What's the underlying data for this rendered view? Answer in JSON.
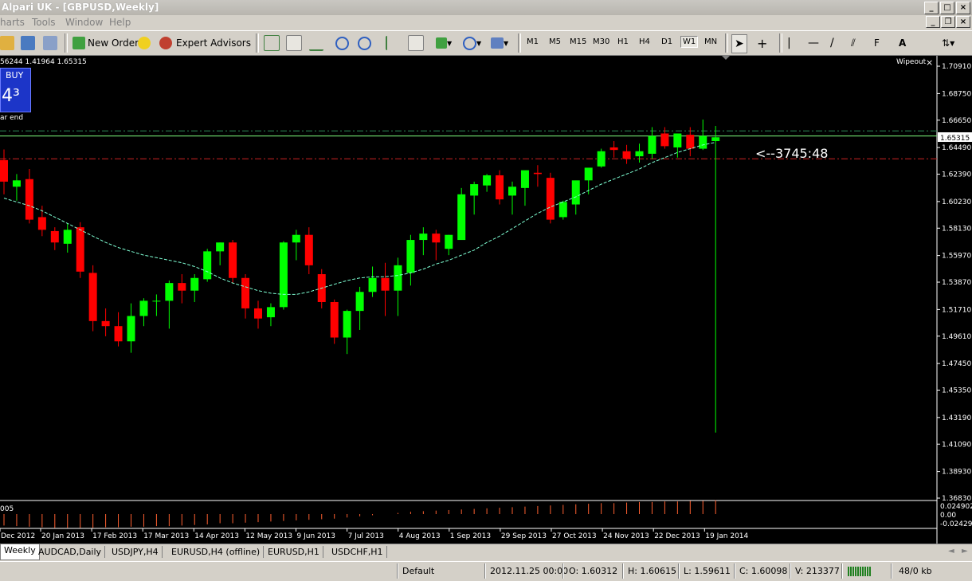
{
  "window": {
    "title": "Alpari UK - [GBPUSD,Weekly]"
  },
  "menu": [
    "harts",
    "Tools",
    "Window",
    "Help"
  ],
  "toolbar": {
    "new_order": "New Order",
    "expert_advisors": "Expert Advisors",
    "timeframes": [
      "M1",
      "M5",
      "M15",
      "M30",
      "H1",
      "H4",
      "D1",
      "W1",
      "MN"
    ],
    "active_timeframe": "W1"
  },
  "chart": {
    "ohlc_line": "56244 1.41964 1.65315",
    "buy_label": "BUY",
    "buy_price": "4³",
    "bar_end": "ar end",
    "wipeout": "Wipeout",
    "countdown": "<--3745:48",
    "indicator_label": "005"
  },
  "chart_data": {
    "type": "candlestick",
    "symbol": "GBPUSD",
    "timeframe": "Weekly",
    "ylim": [
      1.3683,
      1.7173
    ],
    "price_ticks": [
      "1.70910",
      "1.68750",
      "1.66650",
      "1.64490",
      "1.62390",
      "1.60230",
      "1.58130",
      "1.55970",
      "1.53870",
      "1.51710",
      "1.49610",
      "1.47450",
      "1.45350",
      "1.43190",
      "1.41090",
      "1.38930",
      "1.36830"
    ],
    "current_price": "1.65315",
    "x_labels": [
      "Dec 2012",
      "20 Jan 2013",
      "17 Feb 2013",
      "17 Mar 2013",
      "14 Apr 2013",
      "12 May 2013",
      "9 Jun 2013",
      "7 Jul 2013",
      "4 Aug 2013",
      "1 Sep 2013",
      "29 Sep 2013",
      "27 Oct 2013",
      "24 Nov 2013",
      "22 Dec 2013",
      "19 Jan 2014"
    ],
    "candles": [
      [
        1.635,
        1.6434,
        1.608,
        1.618
      ],
      [
        1.614,
        1.624,
        1.603,
        1.619
      ],
      [
        1.62,
        1.628,
        1.585,
        1.588
      ],
      [
        1.59,
        1.599,
        1.575,
        1.58
      ],
      [
        1.579,
        1.582,
        1.564,
        1.57
      ],
      [
        1.569,
        1.585,
        1.562,
        1.58
      ],
      [
        1.582,
        1.586,
        1.542,
        1.547
      ],
      [
        1.546,
        1.552,
        1.5,
        1.508
      ],
      [
        1.508,
        1.518,
        1.496,
        1.504
      ],
      [
        1.504,
        1.515,
        1.488,
        1.492
      ],
      [
        1.492,
        1.522,
        1.483,
        1.512
      ],
      [
        1.512,
        1.526,
        1.504,
        1.524
      ],
      [
        1.524,
        1.529,
        1.512,
        1.524
      ],
      [
        1.524,
        1.54,
        1.502,
        1.538
      ],
      [
        1.538,
        1.545,
        1.522,
        1.532
      ],
      [
        1.532,
        1.545,
        1.523,
        1.542
      ],
      [
        1.541,
        1.565,
        1.539,
        1.563
      ],
      [
        1.563,
        1.57,
        1.552,
        1.57
      ],
      [
        1.57,
        1.572,
        1.538,
        1.542
      ],
      [
        1.542,
        1.545,
        1.51,
        1.518
      ],
      [
        1.518,
        1.524,
        1.502,
        1.51
      ],
      [
        1.511,
        1.522,
        1.504,
        1.519
      ],
      [
        1.519,
        1.571,
        1.517,
        1.57
      ],
      [
        1.57,
        1.58,
        1.556,
        1.576
      ],
      [
        1.576,
        1.582,
        1.545,
        1.552
      ],
      [
        1.545,
        1.549,
        1.518,
        1.523
      ],
      [
        1.523,
        1.525,
        1.49,
        1.495
      ],
      [
        1.495,
        1.517,
        1.482,
        1.516
      ],
      [
        1.516,
        1.535,
        1.501,
        1.531
      ],
      [
        1.531,
        1.551,
        1.527,
        1.542
      ],
      [
        1.542,
        1.554,
        1.512,
        1.532
      ],
      [
        1.532,
        1.558,
        1.512,
        1.552
      ],
      [
        1.546,
        1.576,
        1.536,
        1.572
      ],
      [
        1.572,
        1.582,
        1.56,
        1.577
      ],
      [
        1.577,
        1.58,
        1.556,
        1.57
      ],
      [
        1.565,
        1.576,
        1.56,
        1.576
      ],
      [
        1.572,
        1.613,
        1.573,
        1.608
      ],
      [
        1.607,
        1.618,
        1.592,
        1.616
      ],
      [
        1.615,
        1.624,
        1.61,
        1.623
      ],
      [
        1.623,
        1.627,
        1.6,
        1.604
      ],
      [
        1.607,
        1.618,
        1.592,
        1.614
      ],
      [
        1.613,
        1.625,
        1.599,
        1.627
      ],
      [
        1.625,
        1.631,
        1.614,
        1.624
      ],
      [
        1.621,
        1.625,
        1.585,
        1.588
      ],
      [
        1.59,
        1.603,
        1.588,
        1.602
      ],
      [
        1.6,
        1.615,
        1.592,
        1.619
      ],
      [
        1.619,
        1.627,
        1.608,
        1.629
      ],
      [
        1.63,
        1.644,
        1.629,
        1.642
      ],
      [
        1.645,
        1.65,
        1.637,
        1.643
      ],
      [
        1.642,
        1.647,
        1.632,
        1.636
      ],
      [
        1.638,
        1.648,
        1.633,
        1.642
      ],
      [
        1.64,
        1.661,
        1.636,
        1.654
      ],
      [
        1.656,
        1.661,
        1.644,
        1.646
      ],
      [
        1.645,
        1.656,
        1.637,
        1.656
      ],
      [
        1.655,
        1.661,
        1.638,
        1.644
      ],
      [
        1.644,
        1.667,
        1.643,
        1.654
      ],
      [
        1.65,
        1.662,
        1.42,
        1.653
      ]
    ],
    "ma": [
      1.605,
      1.602,
      1.599,
      1.595,
      1.59,
      1.585,
      1.58,
      1.575,
      1.57,
      1.566,
      1.563,
      1.56,
      1.558,
      1.556,
      1.554,
      1.551,
      1.547,
      1.542,
      1.538,
      1.535,
      1.532,
      1.53,
      1.529,
      1.529,
      1.531,
      1.534,
      1.537,
      1.54,
      1.542,
      1.543,
      1.543,
      1.544,
      1.546,
      1.549,
      1.553,
      1.556,
      1.56,
      1.564,
      1.57,
      1.575,
      1.581,
      1.587,
      1.593,
      1.598,
      1.602,
      1.606,
      1.611,
      1.616,
      1.62,
      1.624,
      1.628,
      1.633,
      1.637,
      1.641,
      1.644,
      1.647,
      1.649
    ],
    "levels": [
      {
        "price": 1.658,
        "color": "#2e8b57",
        "style": "dashdot"
      },
      {
        "price": 1.654,
        "color": "#7fff7f",
        "style": "solid"
      },
      {
        "price": 1.636,
        "color": "#cc2222",
        "style": "dashdot"
      }
    ],
    "indicator_ticks": [
      "0.024902",
      "0.00",
      "-0.024294"
    ]
  },
  "tabs": [
    "Weekly",
    "AUDCAD,Daily",
    "USDJPY,H4",
    "EURUSD,H4 (offline)",
    "EURUSD,H1",
    "USDCHF,H1"
  ],
  "status": {
    "profile": "Default",
    "datetime": "2012.11.25 00:00",
    "open": "O: 1.60312",
    "high": "H: 1.60615",
    "low": "L: 1.59611",
    "close": "C: 1.60098",
    "volume": "V: 213377",
    "traffic": "48/0 kb"
  },
  "colors": {
    "bull": "#00ff00",
    "bear": "#ff0000",
    "ma": "#7fffd4",
    "chart_bg": "#000000"
  }
}
